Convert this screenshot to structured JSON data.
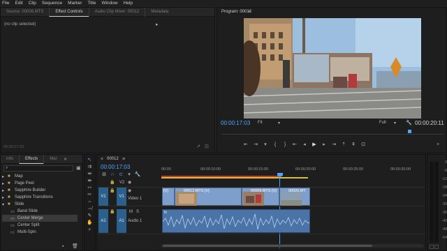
{
  "menu": [
    "File",
    "Edit",
    "Clip",
    "Sequence",
    "Marker",
    "Title",
    "Window",
    "Help"
  ],
  "source_panel": {
    "tabs": [
      "Source: 00006.MTS",
      "Effect Controls",
      "Audio Clip Mixer: 00012",
      "Metadata"
    ],
    "active_tab": 1,
    "no_clip_text": "(no clip selected)",
    "bottom_timecode": "00:00:17:03"
  },
  "program_panel": {
    "title": "Program: 00012",
    "current_time": "00:00:17:03",
    "fit_label": "Fit",
    "quality_label": "Full",
    "duration": "00:00:20:11",
    "playhead_fraction": 0.845
  },
  "project_panel": {
    "tabs": [
      "Info",
      "Effects",
      "Mar"
    ],
    "active_tab": 1,
    "items": [
      {
        "label": "Map",
        "type": "folder",
        "indent": 0
      },
      {
        "label": "Page Peel",
        "type": "folder",
        "indent": 0
      },
      {
        "label": "Sapphire Builder",
        "type": "folder",
        "indent": 0
      },
      {
        "label": "Sapphire Transitions",
        "type": "folder",
        "indent": 0
      },
      {
        "label": "Slide",
        "type": "folder-open",
        "indent": 0
      },
      {
        "label": "Band Slide",
        "type": "effect",
        "indent": 1
      },
      {
        "label": "Center Merge",
        "type": "effect",
        "indent": 1,
        "selected": true
      },
      {
        "label": "Center Split",
        "type": "effect",
        "indent": 1
      },
      {
        "label": "Multi-Spin",
        "type": "effect",
        "indent": 1
      }
    ]
  },
  "timeline": {
    "tab": "00012",
    "current_time": "00:00:17:03",
    "ruler": [
      "00:00",
      "00:00:10:00",
      "00:00:15:00",
      "00:00:20:00",
      "00:00:25:00",
      "00:00:30:00"
    ],
    "tracks": {
      "v1_source": "V1",
      "v1": "V1",
      "v1_name": "Video 1",
      "v2": "V2",
      "a1_source": "A1",
      "a1": "A1",
      "a1_name": "Audio 1",
      "m": "M",
      "s": "S",
      "fx": "fx"
    },
    "clips": [
      {
        "label": "[V]",
        "type": "video"
      },
      {
        "label": "00012.MTS [V]",
        "type": "video"
      },
      {
        "label": "00009.MTS [V]",
        "type": "video"
      },
      {
        "label": "00020.MT",
        "type": "video"
      }
    ]
  },
  "meter_scale": [
    "0",
    "-6",
    "-12",
    "-18",
    "-24",
    "-30",
    "-36",
    "-42",
    "-48",
    "-54"
  ],
  "colors": {
    "accent": "#4ea5ff",
    "clip_video": "#7e9fcb",
    "clip_audio": "#4a74a8",
    "track_badge": "#2b5f8c",
    "work_area": "#d9c23a",
    "render_bar": "#c33a3a"
  }
}
